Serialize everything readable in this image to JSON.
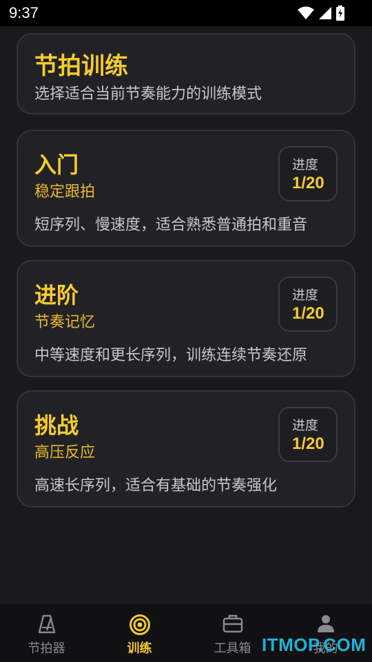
{
  "status": {
    "time": "9:37"
  },
  "header": {
    "title": "节拍训练",
    "subtitle": "选择适合当前节奏能力的训练模式"
  },
  "levels": [
    {
      "name": "入门",
      "subtitle": "稳定跟拍",
      "desc": "短序列、慢速度，适合熟悉普通拍和重音",
      "progress_label": "进度",
      "progress": "1/20"
    },
    {
      "name": "进阶",
      "subtitle": "节奏记忆",
      "desc": "中等速度和更长序列，训练连续节奏还原",
      "progress_label": "进度",
      "progress": "1/20"
    },
    {
      "name": "挑战",
      "subtitle": "高压反应",
      "desc": "高速长序列，适合有基础的节奏强化",
      "progress_label": "进度",
      "progress": "1/20"
    }
  ],
  "nav": {
    "items": [
      {
        "label": "节拍器",
        "icon": "metronome-icon"
      },
      {
        "label": "训练",
        "icon": "target-icon"
      },
      {
        "label": "工具箱",
        "icon": "toolbox-icon"
      },
      {
        "label": "我的",
        "icon": "person-icon"
      }
    ],
    "active_index": 1
  },
  "watermark": "ITMOP.COM",
  "colors": {
    "accent": "#f6cc2f",
    "background": "#1a1a1d",
    "card": "#222226"
  }
}
